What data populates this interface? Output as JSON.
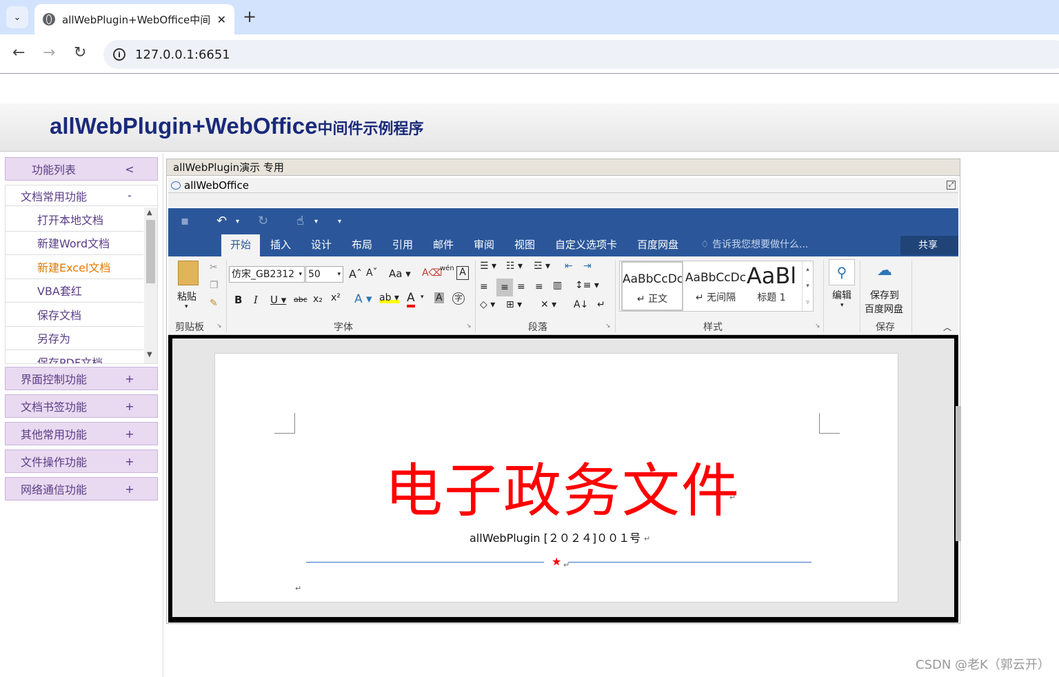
{
  "browser": {
    "tab_title": "allWebPlugin+WebOffice中间",
    "url": "127.0.0.1:6651"
  },
  "header": {
    "title_main": "allWebPlugin+WebOffice",
    "title_suffix": "中间件示例程序"
  },
  "sidebar": {
    "groups": [
      {
        "label": "功能列表",
        "mark": "<"
      },
      {
        "label": "界面控制功能",
        "mark": "+"
      },
      {
        "label": "文档书签功能",
        "mark": "+"
      },
      {
        "label": "其他常用功能",
        "mark": "+"
      },
      {
        "label": "文件操作功能",
        "mark": "+"
      },
      {
        "label": "网络通信功能",
        "mark": "+"
      }
    ],
    "subgroup": {
      "label": "文档常用功能",
      "mark": "-",
      "items": [
        "打开本地文档",
        "新建Word文档",
        "新建Excel文档",
        "VBA套红",
        "保存文档",
        "另存为",
        "保存PDF文档"
      ]
    }
  },
  "panel": {
    "title": "allWebPlugin演示  专用",
    "frame_title": "allWebOffice"
  },
  "ribbon": {
    "tabs": [
      "开始",
      "插入",
      "设计",
      "布局",
      "引用",
      "邮件",
      "审阅",
      "视图",
      "自定义选项卡",
      "百度网盘"
    ],
    "tell_me": "告诉我您想要做什么...",
    "share": "共享",
    "paste": "粘贴",
    "font_name": "仿宋_GB2312",
    "font_size": "50",
    "change_case": "Aa",
    "phonetic": "wén",
    "styles": [
      {
        "sample": "AaBbCcDc",
        "name": "正文"
      },
      {
        "sample": "AaBbCcDc",
        "name": "无间隔"
      },
      {
        "sample": "AaBl",
        "name": "标题 1"
      }
    ],
    "edit": "编辑",
    "save_to": "保存到",
    "baidu_disk": "百度网盘",
    "groups": [
      "剪贴板",
      "字体",
      "段落",
      "样式",
      "保存"
    ]
  },
  "document": {
    "title": "电子政务文件",
    "number": "allWebPlugin [２０２４]００１号"
  },
  "watermark": "CSDN @老K（郭云开）"
}
